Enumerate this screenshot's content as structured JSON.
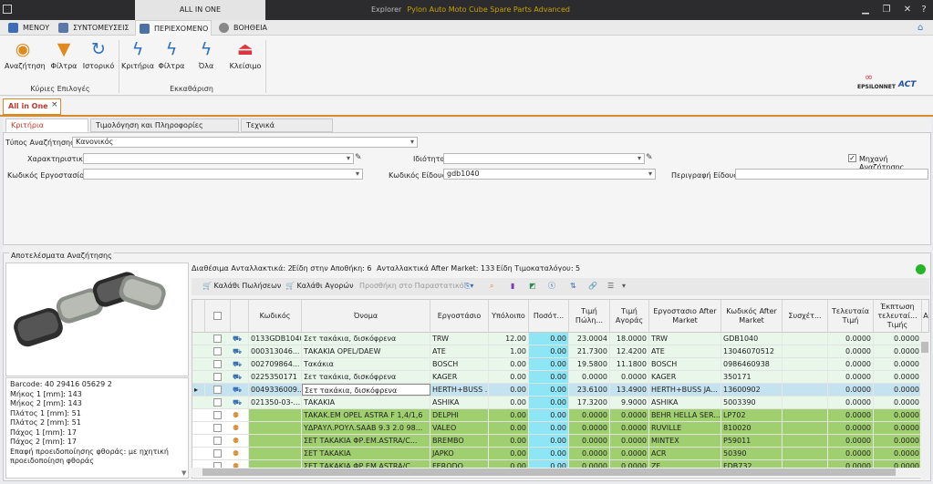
{
  "app": {
    "context_tab": "ALL IN ONE",
    "window_title": "Explorer",
    "product": "Pylon Auto Moto Cube Spare Parts Advanced"
  },
  "ribbon_tabs": [
    {
      "label": "ΜΕΝΟΥ"
    },
    {
      "label": "ΣΥΝΤΟΜΕΥΣΕΙΣ"
    },
    {
      "label": "ΠΕΡΙΕΧΟΜΕΝΟ"
    },
    {
      "label": "ΒΟΗΘΕΙΑ"
    }
  ],
  "ribbon": {
    "main_group": {
      "label": "Κύριες Επιλογές",
      "buttons": [
        {
          "label": "Αναζήτηση"
        },
        {
          "label": "Φίλτρα"
        },
        {
          "label": "Ιστορικό"
        }
      ]
    },
    "clear_group": {
      "label": "Εκκαθάριση",
      "buttons": [
        {
          "label": "Κριτήρια"
        },
        {
          "label": "Φίλτρα"
        },
        {
          "label": "Όλα"
        },
        {
          "label": "Κλείσιμο"
        }
      ]
    }
  },
  "logos": {
    "epsilon": "EPSILONNET",
    "act": "ACT"
  },
  "doc_tab": {
    "label": "All in One",
    "close": "×"
  },
  "search_tabs": [
    {
      "label": "Κριτήρια Αναζήτησης"
    },
    {
      "label": "Τιμολόγηση και Πληροφορίες Υπολοίπου"
    },
    {
      "label": "Τεχνικά Χαρακτηριστικά"
    }
  ],
  "criteria": {
    "search_type_label": "Τύπος Αναζήτησης",
    "search_type_value": "Κανονικός",
    "characteristic_label": "Χαρακτηριστικό",
    "characteristic_value": "",
    "property_label": "Ιδιότητα",
    "property_value": "",
    "engine_search_label": "Μηχανή Αναζήτησης",
    "engine_search_checked": true,
    "factory_code_label": "Κωδικός Εργοστασίου",
    "factory_code_value": "",
    "item_code_label": "Κωδικός Είδους",
    "item_code_value": "gdb1040",
    "description_label": "Περιγραφή Είδους",
    "description_value": ""
  },
  "results": {
    "title": "Αποτελέσματα Αναζήτησης",
    "summary": {
      "spares": "Διαθέσιμα Ανταλλακτικά: 2",
      "in_stock": "Είδη στην Αποθήκη: 6",
      "aftermarket": "Ανταλλακτικά After Market: 133",
      "pricelist": "Είδη Τιμοκαταλόγου: 5"
    },
    "item_info": [
      "Barcode: 40 29416 05629 2",
      "Μήκος 1 [mm]: 143",
      "Μήκος 2 [mm]: 143",
      "Πλάτος 1 [mm]: 51",
      "Πλάτος 2 [mm]: 51",
      "Πάχος 1 [mm]: 17",
      "Πάχος 2 [mm]: 17",
      "Επαφή προειδοποίησης φθοράς: με ηχητική",
      "προειδοποίηση φθοράς"
    ],
    "toolbar": {
      "sales_cart": "Καλάθι Πωλήσεων",
      "purchase_cart": "Καλάθι Αγορών",
      "add_to_doc": "Προσθήκη στο Παραστατικό"
    }
  },
  "grid": {
    "headers": [
      "Κωδικός",
      "Όνομα",
      "Εργοστάσιο",
      "Υπόλοιπο",
      "Ποσότ...",
      "Τιμή Πώλη...",
      "Τιμή Αγοράς",
      "Εργοστασιο After Market",
      "Κωδικός After Market",
      "Συσχέτ...",
      "Τελευταία Τιμή",
      "Έκπτωση τελευταί... Τιμής",
      "Α"
    ],
    "rows": [
      {
        "code": "0133GDB1040",
        "name": "Σετ τακάκια, δισκόφρενα",
        "factory": "TRW",
        "balance": "12.00",
        "qty": "0.00",
        "price_sale": "23.0004",
        "price_buy": "18.0000",
        "am_factory": "TRW",
        "am_code": "GDB1040",
        "rel": "",
        "last_price": "0.0000",
        "last_disc": "0.0000",
        "kind": "stock"
      },
      {
        "code": "000313046...",
        "name": "ΤΑΚΑΚΙΑ OPEL/DAEW",
        "factory": "ATE",
        "balance": "1.00",
        "qty": "0.00",
        "price_sale": "21.7300",
        "price_buy": "12.4200",
        "am_factory": "ATE",
        "am_code": "13046070512",
        "rel": "",
        "last_price": "0.0000",
        "last_disc": "0.0000",
        "kind": "stock"
      },
      {
        "code": "002709864...",
        "name": "Τακάκια",
        "factory": "BOSCH",
        "balance": "0.00",
        "qty": "0.00",
        "price_sale": "19.5800",
        "price_buy": "11.1800",
        "am_factory": "BOSCH",
        "am_code": "0986460938",
        "rel": "",
        "last_price": "0.0000",
        "last_disc": "0.0000",
        "kind": "stock"
      },
      {
        "code": "0225350171",
        "name": "Σετ τακάκια, δισκόφρενα",
        "factory": "KAGER",
        "balance": "0.00",
        "qty": "0.00",
        "price_sale": "0.0000",
        "price_buy": "0.0000",
        "am_factory": "KAGER",
        "am_code": "350171",
        "rel": "",
        "last_price": "0.0000",
        "last_disc": "0.0000",
        "kind": "stock"
      },
      {
        "code": "0049336009...",
        "name": "Σετ τακάκια, δισκόφρενα",
        "factory": "HERTH+BUSS ...",
        "balance": "0.00",
        "qty": "0.00",
        "price_sale": "23.6100",
        "price_buy": "13.4900",
        "am_factory": "HERTH+BUSS JA...",
        "am_code": "13600902",
        "rel": "",
        "last_price": "0.0000",
        "last_disc": "0.0000",
        "kind": "selected"
      },
      {
        "code": "021350-03-...",
        "name": "ΤΑΚΑΚΙΑ",
        "factory": "ASHIKA",
        "balance": "0.00",
        "qty": "0.00",
        "price_sale": "17.3200",
        "price_buy": "9.9000",
        "am_factory": "ASHIKA",
        "am_code": "5003390",
        "rel": "",
        "last_price": "0.0000",
        "last_disc": "0.0000",
        "kind": "stock"
      },
      {
        "code": "",
        "name": "ΤΑΚΑΚ.ΕΜ OPEL ASTRA F 1,4/1,6",
        "factory": "DELPHI",
        "balance": "0.00",
        "qty": "0.00",
        "price_sale": "0.0000",
        "price_buy": "0.0000",
        "am_factory": "BEHR HELLA SER...",
        "am_code": "LP702",
        "rel": "",
        "last_price": "0.0000",
        "last_disc": "0.0000",
        "kind": "am"
      },
      {
        "code": "",
        "name": "ΥΔΡΑΥΛ.ΡΟΥΛ.SAAB 9.3 2.0 98...",
        "factory": "VALEO",
        "balance": "0.00",
        "qty": "0.00",
        "price_sale": "0.0000",
        "price_buy": "0.0000",
        "am_factory": "RUVILLE",
        "am_code": "810020",
        "rel": "",
        "last_price": "0.0000",
        "last_disc": "0.0000",
        "kind": "am"
      },
      {
        "code": "",
        "name": "ΣΕΤ ΤΑΚΑΚΙΑ ΦΡ.ΕΜ.ASTRA/C...",
        "factory": "BREMBO",
        "balance": "0.00",
        "qty": "0.00",
        "price_sale": "0.0000",
        "price_buy": "0.0000",
        "am_factory": "MINTEX",
        "am_code": "P59011",
        "rel": "",
        "last_price": "0.0000",
        "last_disc": "0.0000",
        "kind": "am"
      },
      {
        "code": "",
        "name": "ΣΕΤ ΤΑΚΑΚΙΑ",
        "factory": "JAPKO",
        "balance": "0.00",
        "qty": "0.00",
        "price_sale": "0.0000",
        "price_buy": "0.0000",
        "am_factory": "ACR",
        "am_code": "50390",
        "rel": "",
        "last_price": "0.0000",
        "last_disc": "0.0000",
        "kind": "am"
      },
      {
        "code": "",
        "name": "ΣΕΤ ΤΑΚΑΚΙΑ ΦΡ.ΕΜ.ASTRA/C...",
        "factory": "FERODO",
        "balance": "0.00",
        "qty": "0.00",
        "price_sale": "0.0000",
        "price_buy": "0.0000",
        "am_factory": "ZF",
        "am_code": "FDB732",
        "rel": "",
        "last_price": "0.0000",
        "last_disc": "0.0000",
        "kind": "am"
      }
    ]
  },
  "colors": {
    "accent": "#d98a2b",
    "qty_col": "#8ee6f4",
    "aftermarket_row": "#9fcf6e",
    "stock_row": "#e9f6ea",
    "selected_row": "#c4e3ee",
    "status": "#26b526"
  }
}
